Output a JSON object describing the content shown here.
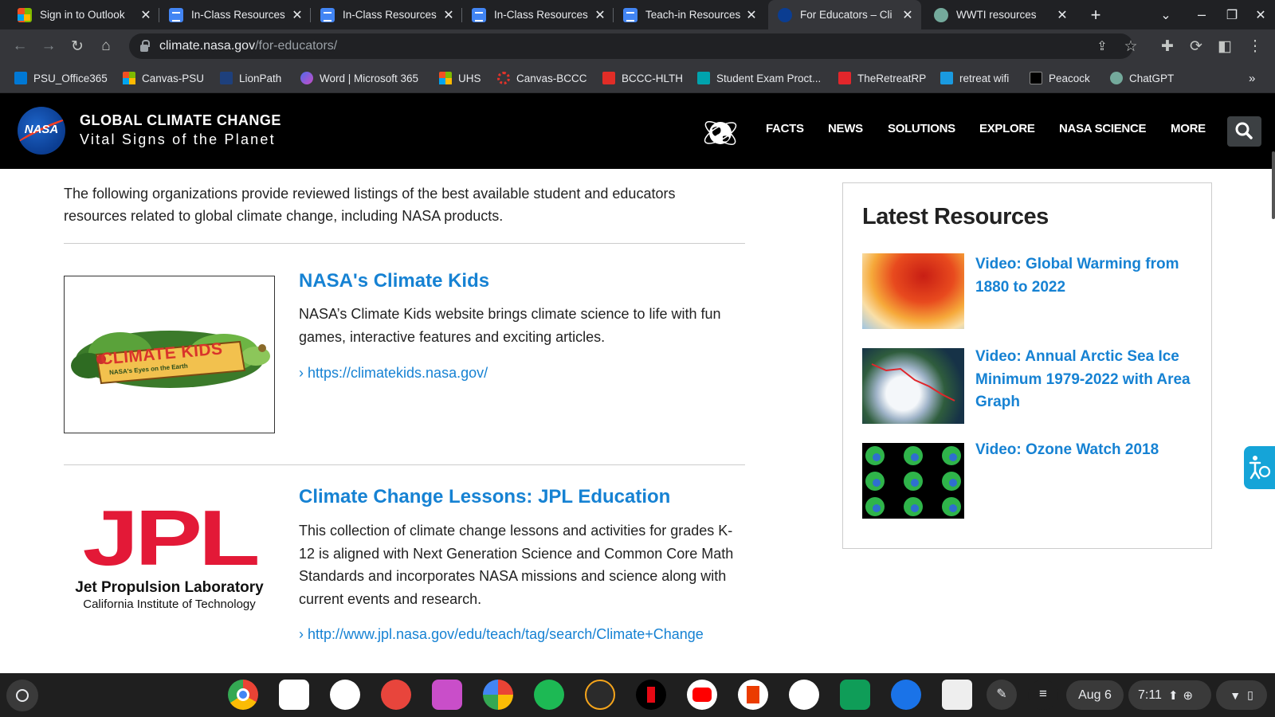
{
  "tabs": [
    {
      "title": "Sign in to Outlook",
      "active": false
    },
    {
      "title": "In-Class Resources",
      "active": false
    },
    {
      "title": "In-Class Resources",
      "active": false
    },
    {
      "title": "In-Class Resources",
      "active": false
    },
    {
      "title": "Teach-in Resources",
      "active": false
    },
    {
      "title": "For Educators – Cli",
      "active": true
    },
    {
      "title": "WWTI resources",
      "active": false
    }
  ],
  "omnibox": {
    "host": "climate.nasa.gov",
    "path": "/for-educators/"
  },
  "bookmarks": [
    "PSU_Office365",
    "Canvas-PSU",
    "LionPath",
    "Word | Microsoft 365",
    "UHS",
    "Canvas-BCCC",
    "BCCC-HLTH",
    "Student Exam Proct...",
    "TheRetreatRP",
    "retreat wifi",
    "Peacock",
    "ChatGPT"
  ],
  "site": {
    "logo_text": "NASA",
    "title_line1": "GLOBAL CLIMATE CHANGE",
    "title_line2": "Vital Signs of the Planet",
    "nav": [
      "FACTS",
      "NEWS",
      "SOLUTIONS",
      "EXPLORE",
      "NASA SCIENCE",
      "MORE"
    ]
  },
  "main": {
    "intro": "The following organizations provide reviewed listings of the best available student and educators resources related to global climate change, including NASA products.",
    "resources": [
      {
        "title": "NASA's Climate Kids",
        "description": "NASA’s Climate Kids website brings climate science to life with fun games, interactive features and exciting articles.",
        "link": "› https://climatekids.nasa.gov/",
        "logo_line1": "CLIMATE KIDS",
        "logo_line2": "NASA's Eyes on the Earth"
      },
      {
        "title": "Climate Change Lessons: JPL Education",
        "description": "This collection of climate change lessons and activities for grades K-12 is aligned with Next Generation Science and Common Core Math Standards and incorporates NASA missions and science along with current events and research.",
        "link": "› http://www.jpl.nasa.gov/edu/teach/tag/search/Climate+Change",
        "logo_big": "JPL",
        "logo_line1": "Jet Propulsion Laboratory",
        "logo_line2": "California Institute of Technology"
      }
    ]
  },
  "sidebar": {
    "heading": "Latest Resources",
    "items": [
      {
        "title": "Video: Global Warming from 1880 to 2022"
      },
      {
        "title": "Video: Annual Arctic Sea Ice Minimum 1979-2022 with Area Graph"
      },
      {
        "title": "Video: Ozone Watch 2018"
      }
    ]
  },
  "shelf": {
    "date": "Aug 6",
    "time": "7:11"
  },
  "colors": {
    "link": "#1682d3",
    "header_bg": "#000000",
    "jpl_red": "#e31937",
    "chrome_dark": "#202124"
  }
}
